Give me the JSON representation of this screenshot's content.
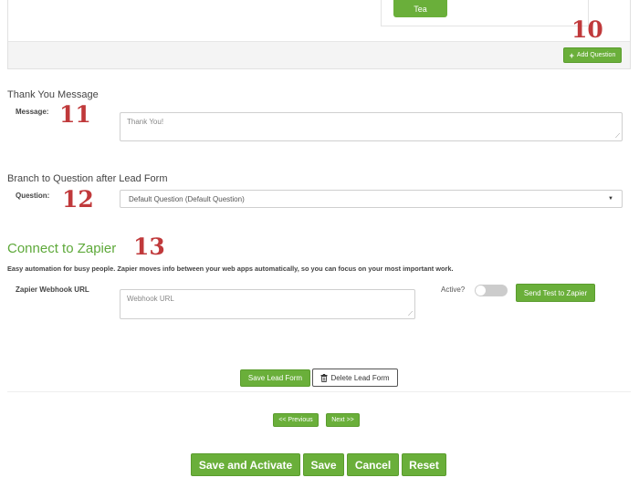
{
  "top_panel": {
    "option_label": "Tea",
    "add_question_label": "Add Question",
    "marker": "10"
  },
  "thank_you": {
    "title": "Thank You Message",
    "message_label": "Message:",
    "message_placeholder": "Thank You!",
    "marker": "11"
  },
  "branch": {
    "title": "Branch to Question after Lead Form",
    "question_label": "Question:",
    "selected": "Default Question (Default Question)",
    "marker": "12"
  },
  "zapier": {
    "title": "Connect to Zapier",
    "marker": "13",
    "description": "Easy automation for busy people. Zapier moves info between your web apps automatically, so you can focus on your most important work.",
    "webhook_label": "Zapier Webhook URL",
    "webhook_placeholder": "Webhook URL",
    "active_label": "Active?",
    "active_on": false,
    "send_test_label": "Send Test to Zapier"
  },
  "form_actions": {
    "save_lead_form": "Save Lead Form",
    "delete_lead_form": "Delete Lead Form"
  },
  "pagination": {
    "previous": "<< Previous",
    "next": "Next >>"
  },
  "footer_actions": {
    "save_and_activate": "Save and Activate",
    "save": "Save",
    "cancel": "Cancel",
    "reset": "Reset"
  },
  "colors": {
    "accent_green": "#6aaf3a",
    "marker_red": "#c0393b",
    "zapier_title_green": "#5ea93a"
  }
}
